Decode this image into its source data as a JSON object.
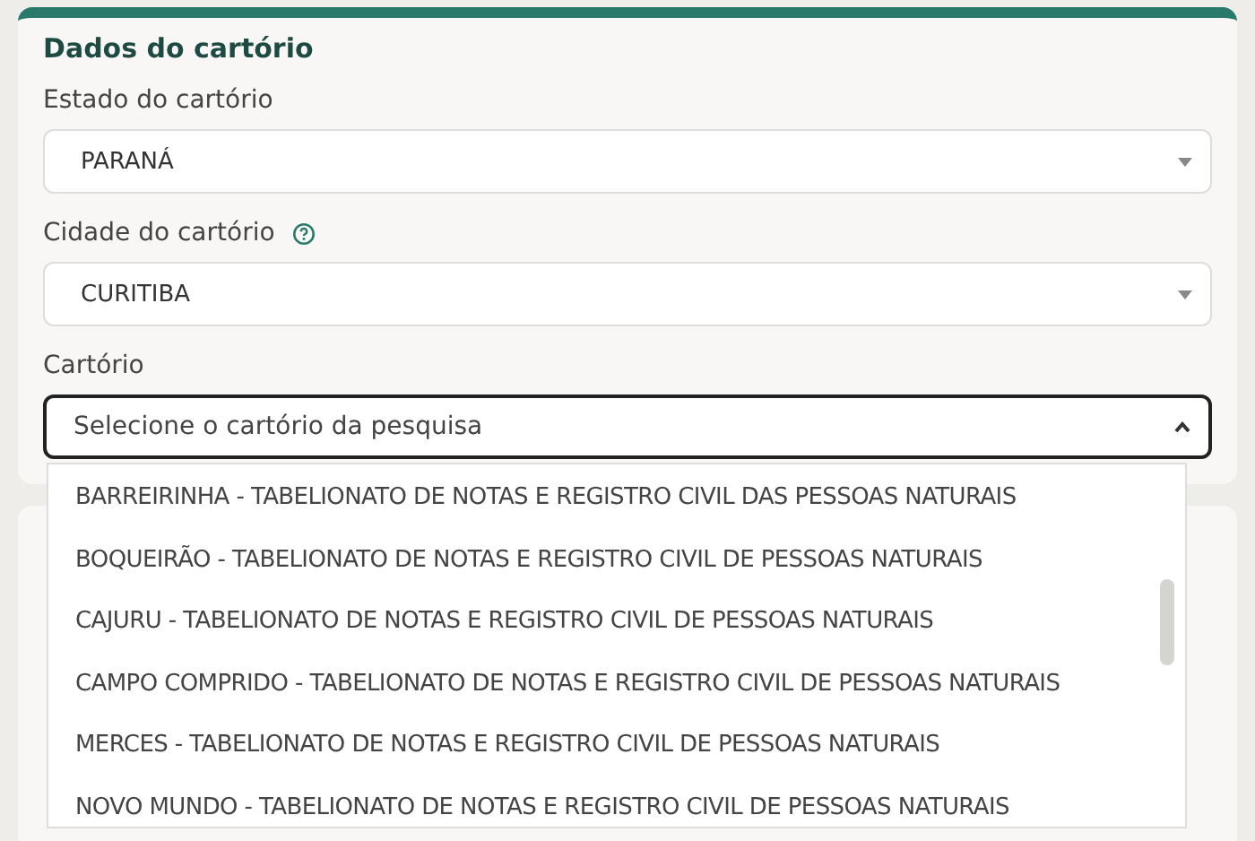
{
  "section_title": "Dados do cartório",
  "fields": [
    {
      "label": "Estado do cartório",
      "value": "PARANÁ",
      "help": false,
      "open": false
    },
    {
      "label": "Cidade do cartório",
      "value": "CURITIBA",
      "help": true,
      "open": false
    },
    {
      "label": "Cartório",
      "placeholder": "Selecione o cartório da pesquisa",
      "help": false,
      "open": true
    }
  ],
  "options": [
    "BARREIRINHA - TABELIONATO DE NOTAS E REGISTRO CIVIL DAS PESSOAS NATURAIS",
    "BOQUEIRÃO - TABELIONATO DE NOTAS E REGISTRO CIVIL DE PESSOAS NATURAIS",
    "CAJURU - TABELIONATO DE NOTAS E REGISTRO CIVIL DE PESSOAS NATURAIS",
    "CAMPO COMPRIDO - TABELIONATO DE NOTAS E REGISTRO CIVIL DE PESSOAS NATURAIS",
    "MERCES - TABELIONATO DE NOTAS E REGISTRO CIVIL DE PESSOAS NATURAIS",
    "NOVO MUNDO - TABELIONATO DE NOTAS E REGISTRO CIVIL DE PESSOAS NATURAIS"
  ]
}
